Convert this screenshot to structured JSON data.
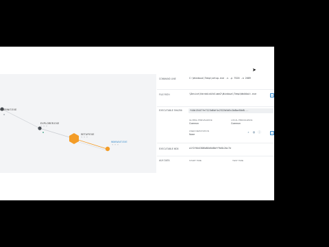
{
  "graph": {
    "nodes": [
      {
        "label": "USERINIT.EXE",
        "mini": "⚬ ⚬"
      },
      {
        "label": "EXPLORER.EXE",
        "mini": "⚬ ⚬ ⚬"
      },
      {
        "label": "SETUP.EXE",
        "mini": "⚬ ⚬ ⚬"
      },
      {
        "label": "WMIWAIT.EXE",
        "mini": "⚬ ⚬ ⚬"
      }
    ]
  },
  "details": {
    "command_line": {
      "label": "COMMAND LINE",
      "value": "C:\\Windows\\Temp\\setup.exe -s -p 7526 -a 2689"
    },
    "file_path": {
      "label": "FILE PATH",
      "value": "\\Device\\HarddiskVolume2\\Windows\\Temp\\WmiWait.exe"
    },
    "executable_hash": {
      "label": "EXECUTABLE SHA256",
      "value": "f44b13447fe7123d6bf4c2322b5d5c2b8be50d8..."
    },
    "global_prevalence": {
      "label": "GLOBAL PREVALENCE",
      "value": "Common"
    },
    "local_prevalence": {
      "label": "LOCAL PREVALENCE",
      "value": "Common"
    },
    "user_reputation": {
      "label": "USER REPUTATION",
      "value": "None"
    },
    "executable_md5": {
      "label": "EXECUTABLE MD5",
      "value": "a1f2f6e4308b80e6d8bff9e8c2bc7e"
    },
    "bottom_row": {
      "label": "AUX DATA",
      "col1": "START TIME",
      "col2": "TEST TIME"
    }
  },
  "colors": {
    "accent_orange": "#f39c27",
    "accent_blue": "#2f86c9",
    "node_gray": "#4a4f55"
  },
  "icons": [
    "search-icon",
    "globe-icon",
    "info-icon",
    "copy-icon"
  ]
}
